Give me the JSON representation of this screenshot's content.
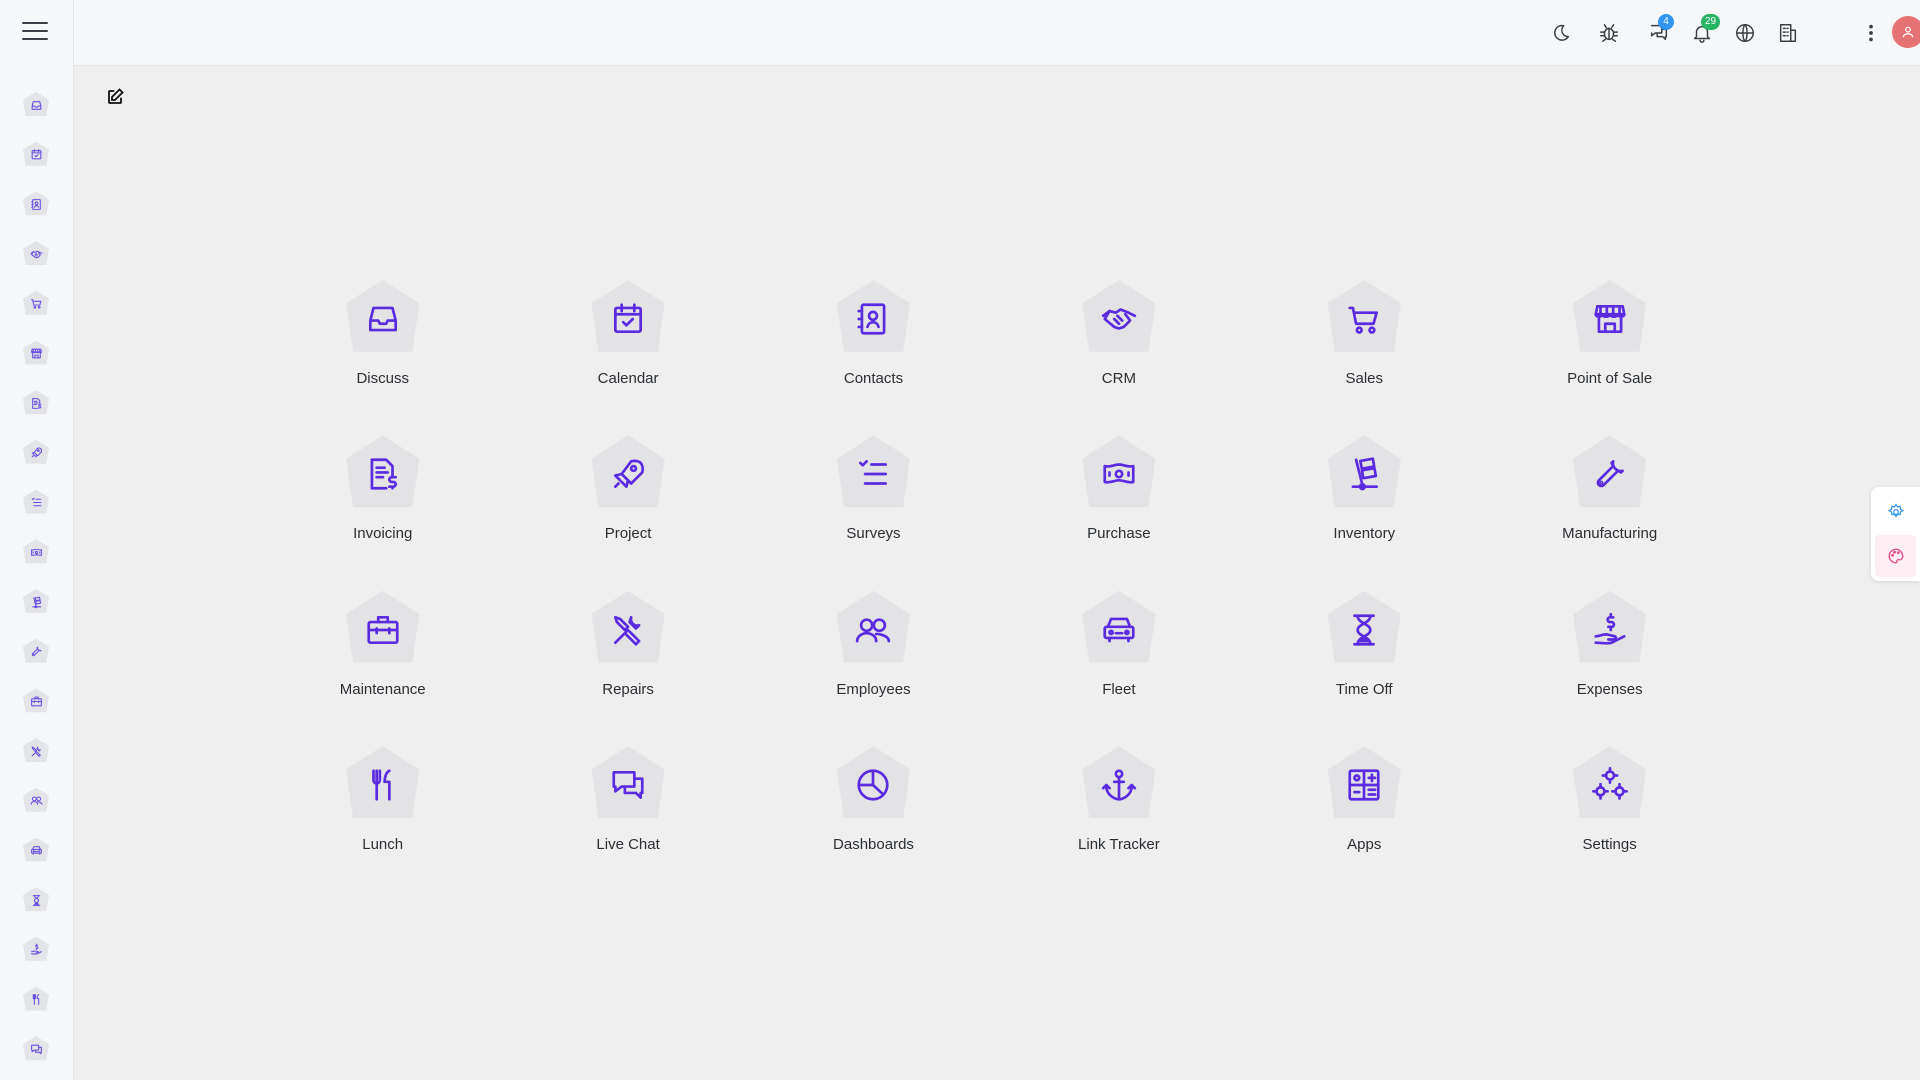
{
  "colors": {
    "accent": "#5b2be0",
    "sidebar_icon": "#6b4fe0",
    "badge_blue": "#2f95f0",
    "badge_green": "#28b463",
    "avatar": "#e57373",
    "float_settings": "#3d9be9",
    "float_palette": "#e24a8a"
  },
  "sidebar": {
    "items": [
      {
        "icon": "inbox-icon"
      },
      {
        "icon": "calendar-icon"
      },
      {
        "icon": "contacts-icon"
      },
      {
        "icon": "handshake-icon"
      },
      {
        "icon": "cart-icon"
      },
      {
        "icon": "store-icon"
      },
      {
        "icon": "invoice-icon"
      },
      {
        "icon": "rocket-icon"
      },
      {
        "icon": "list-check-icon"
      },
      {
        "icon": "money-icon"
      },
      {
        "icon": "dolly-icon"
      },
      {
        "icon": "wrench-icon"
      },
      {
        "icon": "briefcase-icon"
      },
      {
        "icon": "tools-icon"
      },
      {
        "icon": "users-icon"
      },
      {
        "icon": "car-icon"
      },
      {
        "icon": "hourglass-icon"
      },
      {
        "icon": "hand-dollar-icon"
      },
      {
        "icon": "utensils-icon"
      },
      {
        "icon": "chat-icon"
      }
    ]
  },
  "topbar": {
    "icons": [
      {
        "name": "dark-mode-icon"
      },
      {
        "name": "bug-icon"
      },
      {
        "name": "messages-icon",
        "badge": "4"
      },
      {
        "name": "bell-icon",
        "badge": "29"
      },
      {
        "name": "globe-icon"
      },
      {
        "name": "building-icon"
      }
    ]
  },
  "apps": [
    {
      "label": "Discuss",
      "icon": "inbox-icon"
    },
    {
      "label": "Calendar",
      "icon": "calendar-icon"
    },
    {
      "label": "Contacts",
      "icon": "contacts-icon"
    },
    {
      "label": "CRM",
      "icon": "handshake-icon"
    },
    {
      "label": "Sales",
      "icon": "cart-icon"
    },
    {
      "label": "Point of Sale",
      "icon": "store-icon"
    },
    {
      "label": "Invoicing",
      "icon": "invoice-icon"
    },
    {
      "label": "Project",
      "icon": "rocket-icon"
    },
    {
      "label": "Surveys",
      "icon": "list-check-icon"
    },
    {
      "label": "Purchase",
      "icon": "money-icon"
    },
    {
      "label": "Inventory",
      "icon": "dolly-icon"
    },
    {
      "label": "Manufacturing",
      "icon": "wrench-icon"
    },
    {
      "label": "Maintenance",
      "icon": "briefcase-icon"
    },
    {
      "label": "Repairs",
      "icon": "tools-icon"
    },
    {
      "label": "Employees",
      "icon": "users-icon"
    },
    {
      "label": "Fleet",
      "icon": "car-icon"
    },
    {
      "label": "Time Off",
      "icon": "hourglass-icon"
    },
    {
      "label": "Expenses",
      "icon": "hand-dollar-icon"
    },
    {
      "label": "Lunch",
      "icon": "utensils-icon"
    },
    {
      "label": "Live Chat",
      "icon": "chat-icon"
    },
    {
      "label": "Dashboards",
      "icon": "pie-chart-icon"
    },
    {
      "label": "Link Tracker",
      "icon": "anchor-icon"
    },
    {
      "label": "Apps",
      "icon": "apps-grid-icon"
    },
    {
      "label": "Settings",
      "icon": "gears-icon"
    }
  ]
}
